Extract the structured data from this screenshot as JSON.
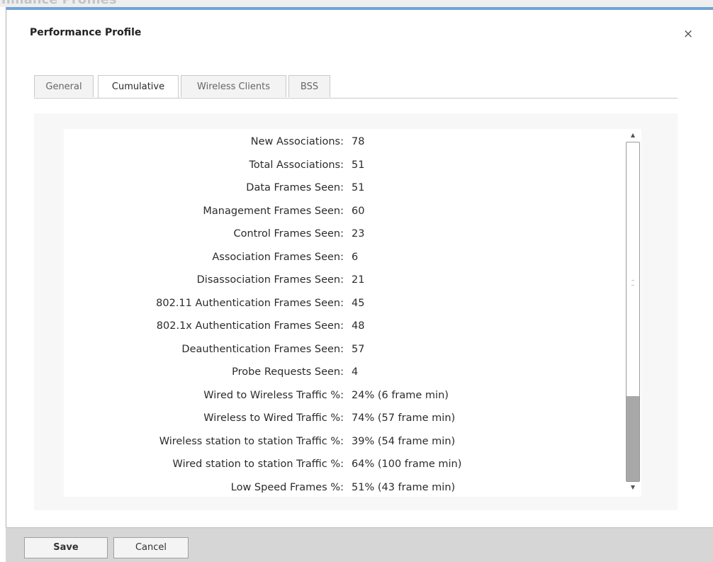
{
  "background": {
    "title_fragment": "nmance Profiles"
  },
  "dialog": {
    "title": "Performance Profile",
    "close_glyph": "×"
  },
  "tabs": [
    {
      "label": "General",
      "active": false
    },
    {
      "label": "Cumulative",
      "active": true
    },
    {
      "label": "Wireless Clients",
      "active": false
    },
    {
      "label": "BSS",
      "active": false
    }
  ],
  "rows": [
    {
      "label": "New Associations:",
      "value": "78"
    },
    {
      "label": "Total Associations:",
      "value": "51"
    },
    {
      "label": "Data Frames Seen:",
      "value": "51"
    },
    {
      "label": "Management Frames Seen:",
      "value": "60"
    },
    {
      "label": "Control Frames Seen:",
      "value": "23"
    },
    {
      "label": "Association Frames Seen:",
      "value": "6"
    },
    {
      "label": "Disassociation Frames Seen:",
      "value": "21"
    },
    {
      "label": "802.11 Authentication Frames Seen:",
      "value": "45"
    },
    {
      "label": "802.1x Authentication Frames Seen:",
      "value": "48"
    },
    {
      "label": "Deauthentication Frames Seen:",
      "value": "57"
    },
    {
      "label": "Probe Requests Seen:",
      "value": "4"
    },
    {
      "label": "Wired to Wireless Traffic %:",
      "value": "24% (6 frame min)"
    },
    {
      "label": "Wireless to Wired Traffic %:",
      "value": "74% (57 frame min)"
    },
    {
      "label": "Wireless station to station Traffic %:",
      "value": "39% (54 frame min)"
    },
    {
      "label": "Wired station to station Traffic %:",
      "value": "64% (100 frame min)"
    },
    {
      "label": "Low Speed Frames %:",
      "value": "51% (43 frame min)"
    }
  ],
  "scrollbar": {
    "up_glyph": "▲",
    "down_glyph": "▼",
    "position_fraction": 1.0
  },
  "footer": {
    "save_label": "Save",
    "cancel_label": "Cancel"
  },
  "colors": {
    "accent_border": "#6fa3d6",
    "footer_bg": "#d6d6d6"
  }
}
